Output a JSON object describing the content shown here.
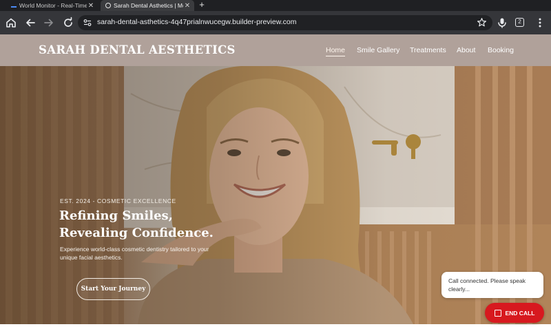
{
  "browser": {
    "tabs": [
      {
        "title": "World Monitor - Real-Time G",
        "active": false,
        "favicon": "world-monitor-icon"
      },
      {
        "title": "Sarah Dental Asthetics | Mo",
        "active": true,
        "favicon": "globe-icon"
      }
    ],
    "url": "sarah-dental-asthetics-4q47prialnwucegw.builder-preview.com",
    "extension_badge": "2"
  },
  "site": {
    "brand": "SARAH DENTAL AESTHETICS",
    "nav": [
      "Home",
      "Smile Gallery",
      "Treatments",
      "About",
      "Booking"
    ],
    "active_nav": "Home"
  },
  "hero": {
    "eyebrow": "EST. 2024 - COSMETIC EXCELLENCE",
    "headline_line1": "Refining Smiles,",
    "headline_line2": "Revealing Confidence.",
    "subcopy": "Experience world-class cosmetic dentistry tailored to your unique facial aesthetics.",
    "cta": "Start Your Journey"
  },
  "call_widget": {
    "status": "Call connected. Please speak clearly...",
    "end_label": "END CALL",
    "end_color": "#d7191f"
  },
  "colors": {
    "header_bg": "#b0a19a",
    "chrome_dark": "#202124"
  }
}
